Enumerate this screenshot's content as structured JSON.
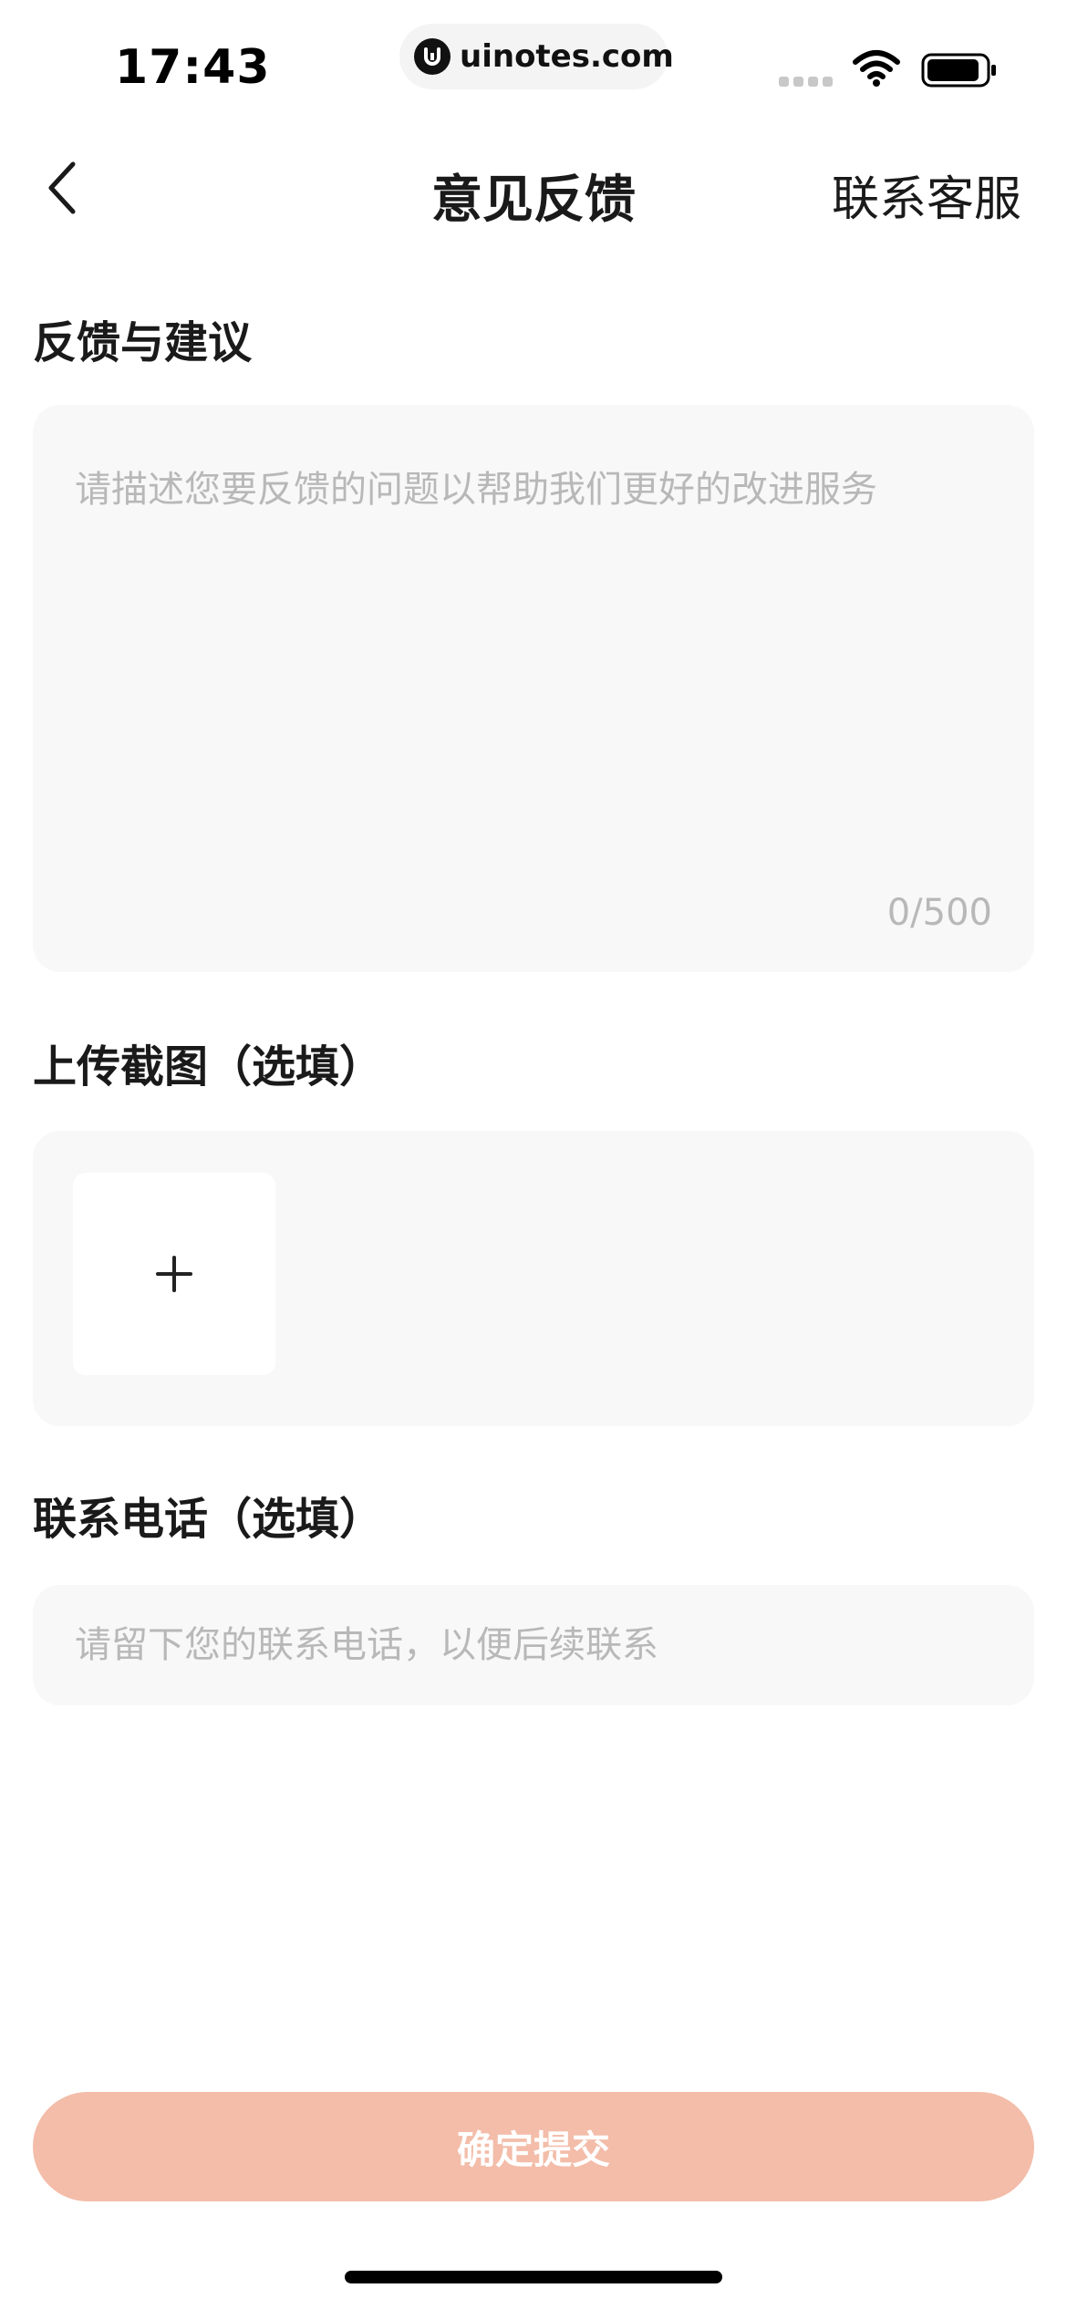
{
  "status_bar": {
    "time": "17:43",
    "url": "uinotes.com",
    "icons": [
      "signal-dots-icon",
      "wifi-icon",
      "battery-icon"
    ]
  },
  "nav": {
    "back_icon": "chevron-left-icon",
    "title": "意见反馈",
    "contact_label": "联系客服"
  },
  "feedback": {
    "label": "反馈与建议",
    "placeholder": "请描述您要反馈的问题以帮助我们更好的改进服务",
    "value": "",
    "char_count": "0/500"
  },
  "upload": {
    "label": "上传截图（选填）",
    "add_icon": "plus-icon"
  },
  "phone": {
    "label": "联系电话（选填）",
    "placeholder": "请留下您的联系电话，以便后续联系",
    "value": ""
  },
  "submit": {
    "label": "确定提交",
    "color": "#f3bda9"
  }
}
